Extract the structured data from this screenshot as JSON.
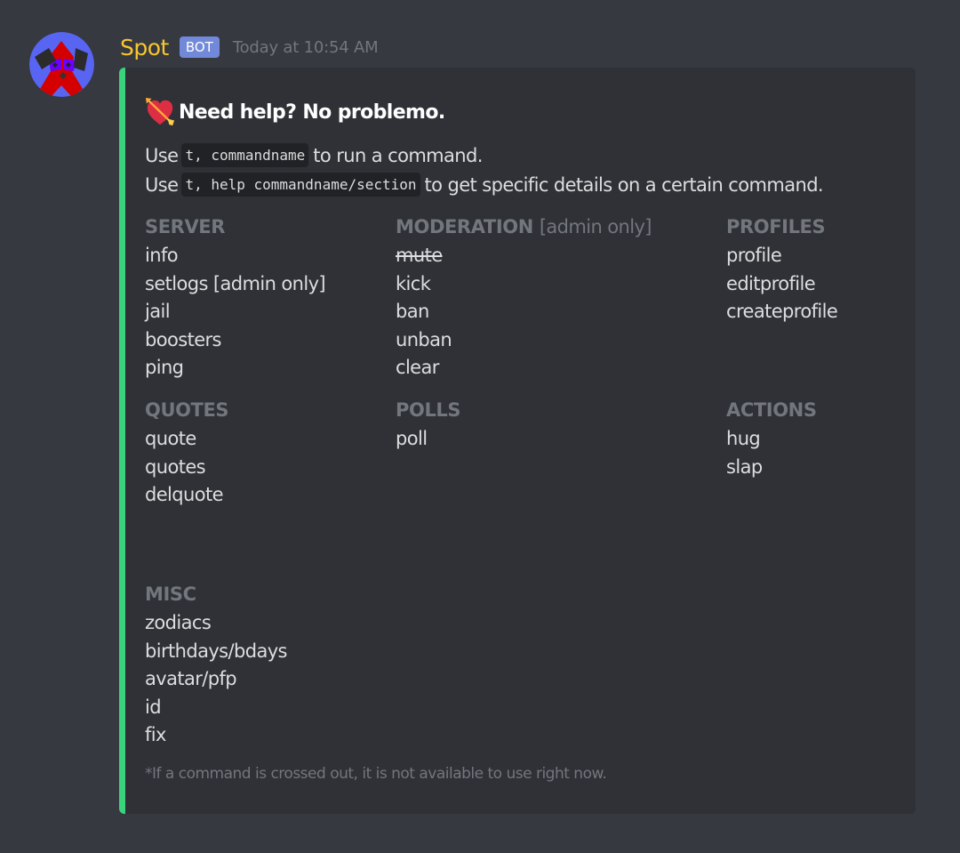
{
  "message": {
    "author": "Spot",
    "bot_tag": "BOT",
    "timestamp": "Today at 10:54 AM",
    "avatar_icon": "dog-face-avatar"
  },
  "embed": {
    "accent_color": "#3ad27b",
    "title_emoji": "heart-with-arrow",
    "title": "Need help? No problemo.",
    "description": [
      {
        "before": "Use",
        "code": "t, commandname",
        "after": "to run a command."
      },
      {
        "before": "Use",
        "code": "t, help commandname/section",
        "after": "to get specific details on a certain command."
      }
    ],
    "fields": [
      {
        "name": "SERVER",
        "suffix": "",
        "items": [
          {
            "label": "info",
            "crossed": false
          },
          {
            "label": "setlogs [admin only]",
            "crossed": false
          },
          {
            "label": "jail",
            "crossed": false
          },
          {
            "label": "boosters",
            "crossed": false
          },
          {
            "label": "ping",
            "crossed": false
          }
        ]
      },
      {
        "name": "MODERATION",
        "suffix": "[admin only]",
        "items": [
          {
            "label": "mute",
            "crossed": true
          },
          {
            "label": "kick",
            "crossed": false
          },
          {
            "label": "ban",
            "crossed": false
          },
          {
            "label": "unban",
            "crossed": false
          },
          {
            "label": "clear",
            "crossed": false
          }
        ]
      },
      {
        "name": "PROFILES",
        "suffix": "",
        "items": [
          {
            "label": "profile",
            "crossed": false
          },
          {
            "label": "editprofile",
            "crossed": false
          },
          {
            "label": "createprofile",
            "crossed": false
          }
        ]
      },
      {
        "name": "QUOTES",
        "suffix": "",
        "items": [
          {
            "label": "quote",
            "crossed": false
          },
          {
            "label": "quotes",
            "crossed": false
          },
          {
            "label": "delquote",
            "crossed": false
          }
        ]
      },
      {
        "name": "POLLS",
        "suffix": "",
        "items": [
          {
            "label": "poll",
            "crossed": false
          }
        ]
      },
      {
        "name": "ACTIONS",
        "suffix": "",
        "items": [
          {
            "label": "hug",
            "crossed": false
          },
          {
            "label": "slap",
            "crossed": false
          }
        ]
      },
      {
        "name": "MISC",
        "suffix": "",
        "items": [
          {
            "label": "zodiacs",
            "crossed": false
          },
          {
            "label": "birthdays/bdays",
            "crossed": false
          },
          {
            "label": "avatar/pfp",
            "crossed": false
          },
          {
            "label": "id",
            "crossed": false
          },
          {
            "label": "fix",
            "crossed": false
          }
        ]
      }
    ],
    "footnote": "*If a command is crossed out, it is not available to use right now."
  }
}
